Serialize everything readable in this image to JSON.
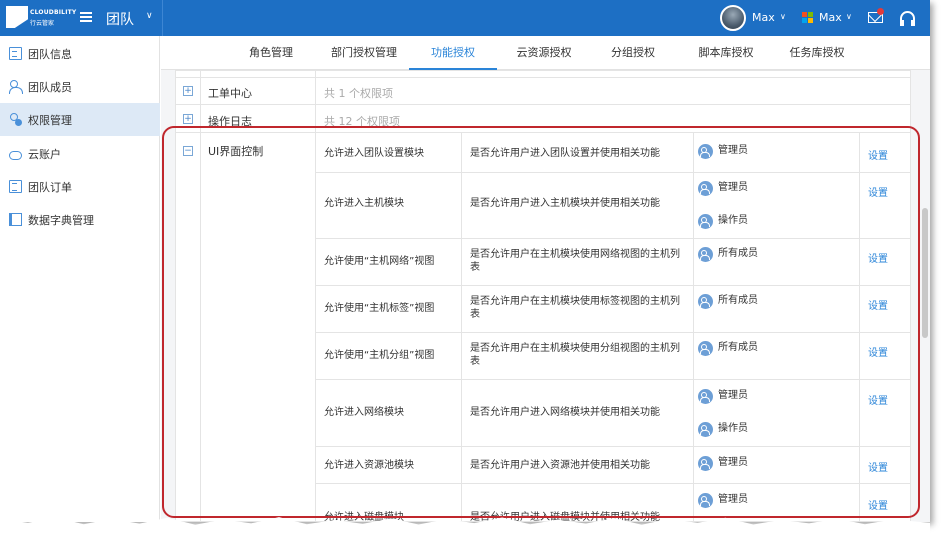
{
  "header": {
    "logo_line1": "CLOUDBILITY",
    "logo_line2": "行云管家",
    "team_title": "团队",
    "user1_name": "Max",
    "user2_name": "Max",
    "brand_color": "#1d6fc4"
  },
  "sidebar": {
    "items": [
      {
        "label": "团队信息",
        "icon": "document-icon"
      },
      {
        "label": "团队成员",
        "icon": "users-icon"
      },
      {
        "label": "权限管理",
        "icon": "permission-icon",
        "active": true
      },
      {
        "label": "云账户",
        "icon": "cloud-icon"
      },
      {
        "label": "团队订单",
        "icon": "order-icon"
      },
      {
        "label": "数据字典管理",
        "icon": "book-icon"
      }
    ]
  },
  "tabs": [
    {
      "label": "角色管理"
    },
    {
      "label": "部门授权管理"
    },
    {
      "label": "功能授权",
      "active": true
    },
    {
      "label": "云资源授权"
    },
    {
      "label": "分组授权"
    },
    {
      "label": "脚本库授权"
    },
    {
      "label": "任务库授权"
    }
  ],
  "groups": [
    {
      "name": "工单中心",
      "count": "共 1 个权限项",
      "expanded": false
    },
    {
      "name": "操作日志",
      "count": "共 12 个权限项",
      "expanded": false
    },
    {
      "name": "UI界面控制",
      "expanded": true
    }
  ],
  "permissions": [
    {
      "name": "允许进入团队设置模块",
      "desc": "是否允许用户进入团队设置并使用相关功能",
      "roles": [
        "管理员"
      ],
      "action": "设置"
    },
    {
      "name": "允许进入主机模块",
      "desc": "是否允许用户进入主机模块并使用相关功能",
      "roles": [
        "管理员",
        "操作员"
      ],
      "action": "设置"
    },
    {
      "name": "允许使用“主机网络”视图",
      "desc": "是否允许用户在主机模块使用网络视图的主机列表",
      "roles": [
        "所有成员"
      ],
      "action": "设置"
    },
    {
      "name": "允许使用“主机标签”视图",
      "desc": "是否允许用户在主机模块使用标签视图的主机列表",
      "roles": [
        "所有成员"
      ],
      "action": "设置"
    },
    {
      "name": "允许使用“主机分组”视图",
      "desc": "是否允许用户在主机模块使用分组视图的主机列表",
      "roles": [
        "所有成员"
      ],
      "action": "设置"
    },
    {
      "name": "允许进入网络模块",
      "desc": "是否允许用户进入网络模块并使用相关功能",
      "roles": [
        "管理员",
        "操作员"
      ],
      "action": "设置"
    },
    {
      "name": "允许进入资源池模块",
      "desc": "是否允许用户进入资源池并使用相关功能",
      "roles": [
        "管理员"
      ],
      "action": "设置"
    },
    {
      "name": "允许进入磁盘模块",
      "desc": "是否允许用户进入磁盘模块并使用相关功能",
      "roles": [
        "管理员"
      ],
      "action": "设置"
    }
  ]
}
